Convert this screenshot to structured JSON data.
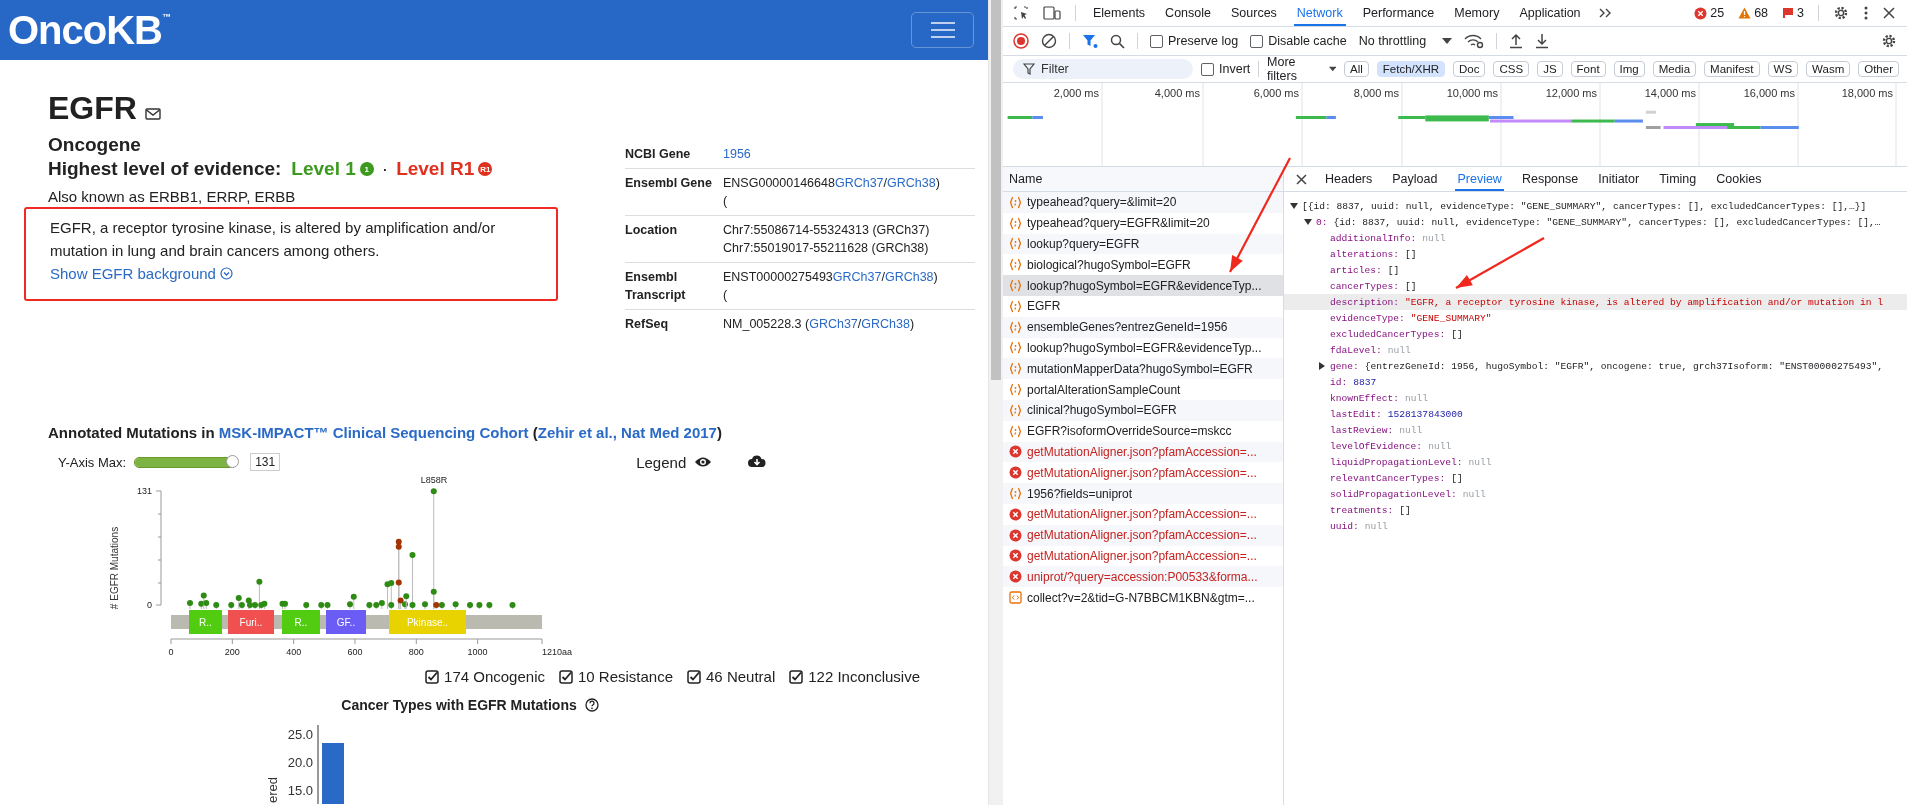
{
  "site": {
    "logo": "OncoKB",
    "logo_mark": "™"
  },
  "gene": {
    "symbol": "EGFR",
    "type": "Oncogene",
    "evidence_label": "Highest level of evidence:",
    "levels": [
      {
        "text": "Level 1",
        "badge": "1",
        "color": "#3c9a1e"
      },
      {
        "text": "Level R1",
        "badge": "R1",
        "color": "#e0301e"
      }
    ],
    "separator": "·",
    "aliases": "Also known as ERBB1, ERRP, ERBB",
    "description": {
      "text": "EGFR, a receptor tyrosine kinase, is altered by amplification and/or mutation in lung and brain cancers among others.",
      "highlighted": true
    },
    "background_link": "Show EGFR background"
  },
  "info_table": [
    {
      "label": "NCBI Gene",
      "lines": [
        [
          {
            "text": "1956",
            "link": true
          }
        ]
      ]
    },
    {
      "label": "Ensembl Gene",
      "lines": [
        [
          {
            "text": "ENSG00000146648",
            "link": false
          },
          {
            "text": "GRCh37",
            "link": true
          },
          {
            "text": "/",
            "link": false
          },
          {
            "text": "GRCh38",
            "link": true
          },
          {
            "text": ")",
            "link": false
          }
        ],
        [
          {
            "text": "(",
            "link": false
          }
        ]
      ]
    },
    {
      "label": "Location",
      "lines": [
        [
          {
            "text": "Chr7:55086714-55324313 (GRCh37)",
            "link": false
          }
        ],
        [
          {
            "text": "Chr7:55019017-55211628 (GRCh38)",
            "link": false
          }
        ]
      ]
    },
    {
      "label": "Ensembl Transcript",
      "lines": [
        [
          {
            "text": "ENST00000275493",
            "link": false
          },
          {
            "text": "GRCh37",
            "link": true
          },
          {
            "text": "/",
            "link": false
          },
          {
            "text": "GRCh38",
            "link": true
          },
          {
            "text": ")",
            "link": false
          }
        ],
        [
          {
            "text": "(",
            "link": false
          }
        ]
      ]
    },
    {
      "label": "RefSeq",
      "lines": [
        [
          {
            "text": "NM_005228.3 (",
            "link": false
          },
          {
            "text": "GRCh37",
            "link": true
          },
          {
            "text": "/",
            "link": false
          },
          {
            "text": "GRCh38",
            "link": true
          },
          {
            "text": ")",
            "link": false
          }
        ]
      ]
    }
  ],
  "mutations": {
    "heading": [
      {
        "text": "Annotated Mutations in ",
        "link": false
      },
      {
        "text": "MSK-IMPACT™ Clinical Sequencing Cohort",
        "link": true
      },
      {
        "text": " (",
        "link": false
      },
      {
        "text": "Zehir et al., Nat Med 2017",
        "link": true
      },
      {
        "text": ")",
        "link": false
      }
    ],
    "y_axis_max": {
      "label": "Y-Axis Max:",
      "level": 1,
      "value": "131"
    },
    "legend": "Legend",
    "plot": {
      "ylabel": "# EGFR Mutations",
      "y_ticks": [
        "131",
        "0"
      ],
      "x_ticks": [
        "0",
        "200",
        "400",
        "600",
        "800",
        "1000",
        "1210aa"
      ],
      "hotspot_label": "L858R",
      "domains": [
        {
          "label": "R..",
          "color": "#52cc10"
        },
        {
          "label": "Furi..",
          "color": "#f05050"
        },
        {
          "label": "R..",
          "color": "#52cc10"
        },
        {
          "label": "GF..",
          "color": "#6a5cf5"
        },
        {
          "label": "Pkinase..",
          "color": "#e8d300"
        }
      ]
    },
    "filters": [
      {
        "label": "174 Oncogenic",
        "checked": true
      },
      {
        "label": "10 Resistance",
        "checked": true
      },
      {
        "label": "46 Neutral",
        "checked": true
      },
      {
        "label": "122 Inconclusive",
        "checked": true
      }
    ]
  },
  "cancer_types": {
    "title": "Cancer Types with EGFR Mutations",
    "chart": {
      "ylabel": "ered",
      "y_ticks": [
        "25.0",
        "20.0",
        "15.0"
      ]
    }
  },
  "annotations": [
    {
      "kind": "arrow"
    },
    {
      "kind": "arrow"
    }
  ],
  "devtools": {
    "tabs": [
      {
        "label": "Elements",
        "selected": false
      },
      {
        "label": "Console",
        "selected": false
      },
      {
        "label": "Sources",
        "selected": false
      },
      {
        "label": "Network",
        "selected": true
      },
      {
        "label": "Performance",
        "selected": false
      },
      {
        "label": "Memory",
        "selected": false
      },
      {
        "label": "Application",
        "selected": false
      }
    ],
    "issues": [
      {
        "kind": "error",
        "count": "25"
      },
      {
        "kind": "warning",
        "count": "68"
      },
      {
        "kind": "info",
        "count": "3"
      }
    ],
    "preserve_log": {
      "label": "Preserve log",
      "checked": false
    },
    "disable_cache": {
      "label": "Disable cache",
      "checked": false
    },
    "throttling": "No throttling",
    "filter": {
      "placeholder": "Filter",
      "invert": {
        "label": "Invert",
        "checked": false
      },
      "more_filters": "More filters",
      "types": [
        {
          "label": "All",
          "selected": false
        },
        {
          "label": "Fetch/XHR",
          "selected": true
        },
        {
          "label": "Doc",
          "selected": false
        },
        {
          "label": "CSS",
          "selected": false
        },
        {
          "label": "JS",
          "selected": false
        },
        {
          "label": "Font",
          "selected": false
        },
        {
          "label": "Img",
          "selected": false
        },
        {
          "label": "Media",
          "selected": false
        },
        {
          "label": "Manifest",
          "selected": false
        },
        {
          "label": "WS",
          "selected": false
        },
        {
          "label": "Wasm",
          "selected": false
        },
        {
          "label": "Other",
          "selected": false
        }
      ]
    },
    "timeline_ticks": [
      "2,000 ms",
      "4,000 ms",
      "6,000 ms",
      "8,000 ms",
      "10,000 ms",
      "12,000 ms",
      "14,000 ms",
      "16,000 ms",
      "18,000 ms"
    ],
    "requests": {
      "header": "Name",
      "rows": [
        {
          "name": "typeahead?query=&limit=20",
          "kind": "fetch",
          "selected": false
        },
        {
          "name": "typeahead?query=EGFR&limit=20",
          "kind": "fetch",
          "selected": false
        },
        {
          "name": "lookup?query=EGFR",
          "kind": "fetch",
          "selected": false
        },
        {
          "name": "biological?hugoSymbol=EGFR",
          "kind": "fetch",
          "selected": false
        },
        {
          "name": "lookup?hugoSymbol=EGFR&evidenceTyp...",
          "kind": "fetch",
          "selected": true
        },
        {
          "name": "EGFR",
          "kind": "fetch",
          "selected": false
        },
        {
          "name": "ensembleGenes?entrezGeneId=1956",
          "kind": "fetch",
          "selected": false
        },
        {
          "name": "lookup?hugoSymbol=EGFR&evidenceTyp...",
          "kind": "fetch",
          "selected": false
        },
        {
          "name": "mutationMapperData?hugoSymbol=EGFR",
          "kind": "fetch",
          "selected": false
        },
        {
          "name": "portalAlterationSampleCount",
          "kind": "fetch",
          "selected": false
        },
        {
          "name": "clinical?hugoSymbol=EGFR",
          "kind": "fetch",
          "selected": false
        },
        {
          "name": "EGFR?isoformOverrideSource=mskcc",
          "kind": "fetch",
          "selected": false
        },
        {
          "name": "getMutationAligner.json?pfamAccession=...",
          "kind": "error",
          "selected": false
        },
        {
          "name": "getMutationAligner.json?pfamAccession=...",
          "kind": "error",
          "selected": false
        },
        {
          "name": "1956?fields=uniprot",
          "kind": "fetch",
          "selected": false
        },
        {
          "name": "getMutationAligner.json?pfamAccession=...",
          "kind": "error",
          "selected": false
        },
        {
          "name": "getMutationAligner.json?pfamAccession=...",
          "kind": "error",
          "selected": false
        },
        {
          "name": "getMutationAligner.json?pfamAccession=...",
          "kind": "error",
          "selected": false
        },
        {
          "name": "uniprot/?query=accession:P00533&forma...",
          "kind": "error",
          "selected": false
        },
        {
          "name": "collect?v=2&tid=G-N7BBCM1KBN&gtm=...",
          "kind": "other",
          "selected": false
        }
      ]
    },
    "detail_tabs": [
      {
        "label": "Headers",
        "selected": false
      },
      {
        "label": "Payload",
        "selected": false
      },
      {
        "label": "Preview",
        "selected": true
      },
      {
        "label": "Response",
        "selected": false
      },
      {
        "label": "Initiator",
        "selected": false
      },
      {
        "label": "Timing",
        "selected": false
      },
      {
        "label": "Cookies",
        "selected": false
      }
    ],
    "preview": {
      "text": "[{id: 8837, uuid: null, evidenceType: \"GENE_SUMMARY\", cancerTypes: [], excludedCancerTypes: [],…}]",
      "expanded": true,
      "selected": false,
      "children": [
        {
          "key": "0:",
          "text": "{id: 8837, uuid: null, evidenceType: \"GENE_SUMMARY\", cancerTypes: [], excludedCancerTypes: [],…",
          "expanded": true,
          "selected": false,
          "children": [
            {
              "key": "additionalInfo:",
              "text": "null",
              "kind": "null",
              "selected": false
            },
            {
              "key": "alterations:",
              "text": "[]",
              "kind": "array",
              "selected": false
            },
            {
              "key": "articles:",
              "text": "[]",
              "kind": "array",
              "selected": false
            },
            {
              "key": "cancerTypes:",
              "text": "[]",
              "kind": "array",
              "selected": false
            },
            {
              "key": "description:",
              "text": "\"EGFR, a receptor tyrosine kinase, is altered by amplification and/or mutation in l",
              "kind": "string",
              "selected": true
            },
            {
              "key": "evidenceType:",
              "text": "\"GENE_SUMMARY\"",
              "kind": "string",
              "selected": false
            },
            {
              "key": "excludedCancerTypes:",
              "text": "[]",
              "kind": "array",
              "selected": false
            },
            {
              "key": "fdaLevel:",
              "text": "null",
              "kind": "null",
              "selected": false
            },
            {
              "key": "gene:",
              "text": "{entrezGeneId: 1956, hugoSymbol: \"EGFR\", oncogene: true, grch37Isoform: \"ENST00000275493\",",
              "expanded": false,
              "selected": false
            },
            {
              "key": "id:",
              "text": "8837",
              "kind": "number",
              "selected": false
            },
            {
              "key": "knownEffect:",
              "text": "null",
              "kind": "null",
              "selected": false
            },
            {
              "key": "lastEdit:",
              "text": "1528137843000",
              "kind": "number",
              "selected": false
            },
            {
              "key": "lastReview:",
              "text": "null",
              "kind": "null",
              "selected": false
            },
            {
              "key": "levelOfEvidence:",
              "text": "null",
              "kind": "null",
              "selected": false
            },
            {
              "key": "liquidPropagationLevel:",
              "text": "null",
              "kind": "null",
              "selected": false
            },
            {
              "key": "relevantCancerTypes:",
              "text": "[]",
              "kind": "array",
              "selected": false
            },
            {
              "key": "solidPropagationLevel:",
              "text": "null",
              "kind": "null",
              "selected": false
            },
            {
              "key": "treatments:",
              "text": "[]",
              "kind": "array",
              "selected": false
            },
            {
              "key": "uuid:",
              "text": "null",
              "kind": "null",
              "selected": false
            }
          ]
        }
      ]
    }
  }
}
